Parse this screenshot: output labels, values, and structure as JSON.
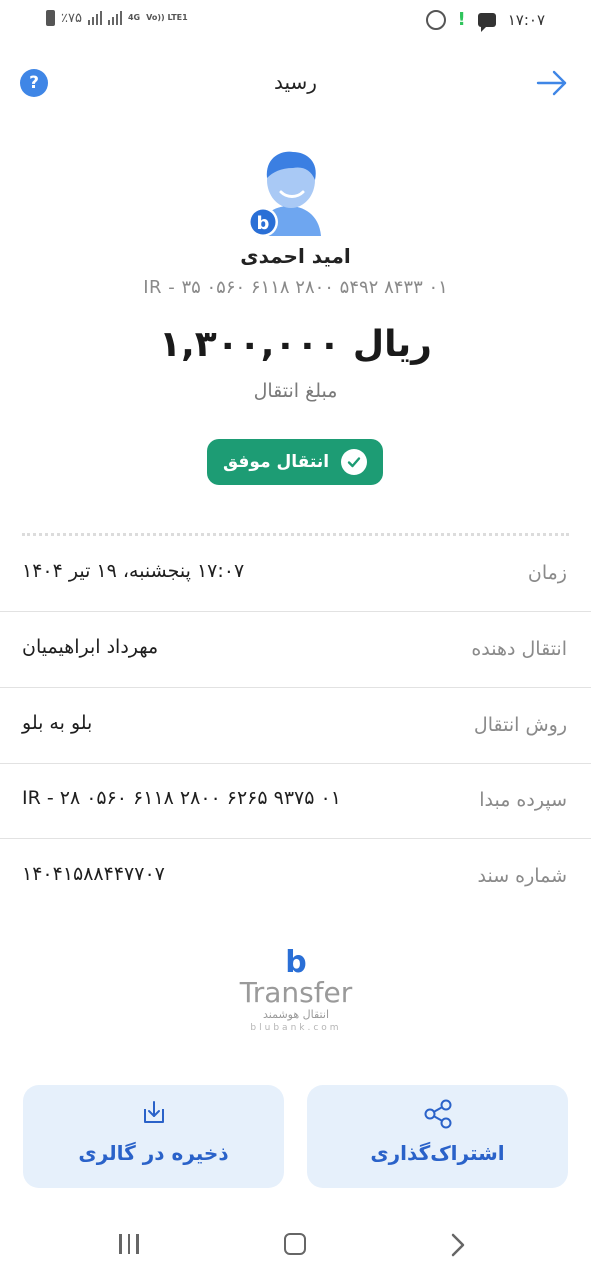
{
  "status_bar": {
    "battery_text": "٪۷۵",
    "network_text": "4G",
    "volte_text": "Vo)) LTE1",
    "time": "۱۷:۰۷"
  },
  "header": {
    "title": "رسید",
    "help_icon": "question-icon",
    "back_icon": "arrow-right-icon"
  },
  "recipient": {
    "name": "امید احمدی",
    "iban": "IR - ۳۵ ۰۵۶۰ ۶۱۱۸ ۲۸۰۰ ۵۴۹۲ ۸۴۳۳ ۰۱",
    "bank_badge": "b"
  },
  "transfer": {
    "amount": "۱,۳۰۰,۰۰۰ ریال",
    "amount_label": "مبلغ انتقال",
    "status_text": "انتقال موفق"
  },
  "details": [
    {
      "label": "زمان",
      "value": "۱۷:۰۷ پنجشنبه، ۱۹ تیر ۱۴۰۴"
    },
    {
      "label": "انتقال دهنده",
      "value": "مهرداد ابراهیمیان"
    },
    {
      "label": "روش انتقال",
      "value": "بلو به بلو"
    },
    {
      "label": "سپرده مبدا",
      "value": "IR - ۲۸ ۰۵۶۰ ۶۱۱۸ ۲۸۰۰ ۶۲۶۵ ۹۳۷۵ ۰۱"
    },
    {
      "label": "شماره سند",
      "value": "۱۴۰۴۱۵۸۸۴۴۷۷۰۷"
    }
  ],
  "brand": {
    "mark": "b",
    "word": "Transfer",
    "subtitle": "انتقال هوشمند",
    "url": "blubank.com"
  },
  "actions": {
    "save_label": "ذخیره در گالری",
    "share_label": "اشتراک‌گذاری"
  },
  "colors": {
    "accent": "#2a62c9",
    "success": "#1d9c74",
    "button_bg": "#e6f0fb"
  }
}
